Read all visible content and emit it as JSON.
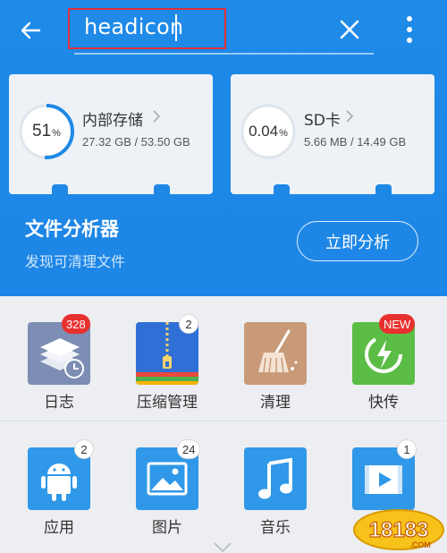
{
  "toolbar": {
    "search_value": "headicon"
  },
  "storage": [
    {
      "percent": "51",
      "percent_sign": "%",
      "title": "内部存储",
      "usage": "27.32 GB / 53.50 GB",
      "fill": 0.51
    },
    {
      "percent": "0.04",
      "percent_sign": "%",
      "title": "SD卡",
      "usage": "5.66 MB / 14.49 GB",
      "fill": 0.0004
    }
  ],
  "analyzer": {
    "title": "文件分析器",
    "subtitle": "发现可清理文件",
    "button": "立即分析"
  },
  "categories": [
    {
      "label": "日志",
      "badge": "328",
      "badge_style": "red",
      "icon": "log-stack-icon"
    },
    {
      "label": "压缩管理",
      "badge": "2",
      "badge_style": "white",
      "icon": "zip-archive-icon"
    },
    {
      "label": "清理",
      "badge": "",
      "badge_style": "",
      "icon": "broom-icon"
    },
    {
      "label": "快传",
      "badge": "NEW",
      "badge_style": "red",
      "icon": "quick-transfer-icon"
    },
    {
      "label": "应用",
      "badge": "2",
      "badge_style": "white",
      "icon": "android-icon"
    },
    {
      "label": "图片",
      "badge": "24",
      "badge_style": "white",
      "icon": "image-icon"
    },
    {
      "label": "音乐",
      "badge": "",
      "badge_style": "",
      "icon": "music-note-icon"
    },
    {
      "label": "视频",
      "badge": "1",
      "badge_style": "white",
      "icon": "video-play-icon"
    }
  ],
  "watermark": {
    "text": "18183",
    "domain": ".COM"
  },
  "colors": {
    "header_blue": "#1e88e6",
    "badge_red": "#e8302f",
    "ring_blue": "#1e88e6"
  }
}
